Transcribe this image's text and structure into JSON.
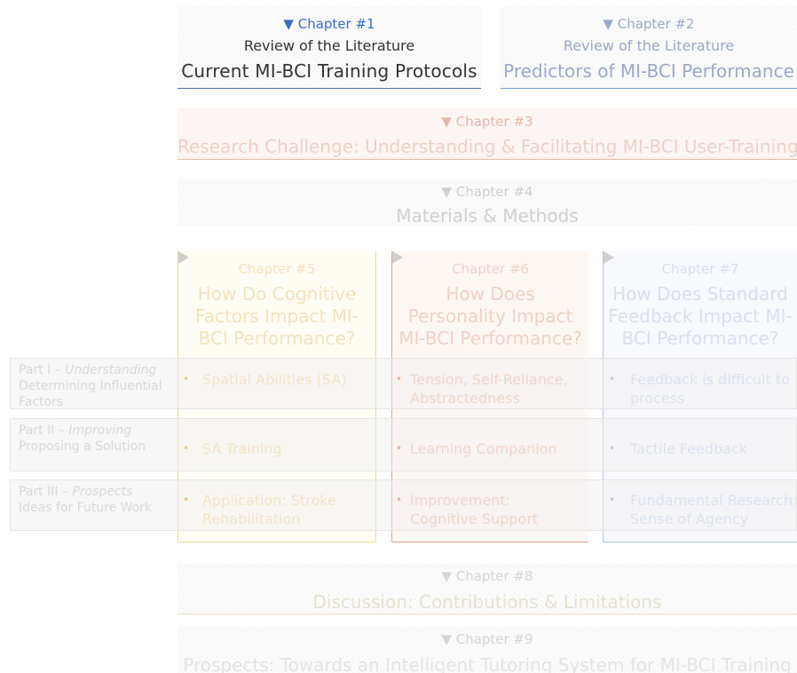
{
  "chapters": {
    "ch1": {
      "label": "▼ Chapter #1",
      "subtitle": "Review of the Literature",
      "title": "Current MI-BCI Training Protocols"
    },
    "ch2": {
      "label": "▼ Chapter #2",
      "subtitle": "Review of the Literature",
      "title": "Predictors of MI-BCI Performance"
    },
    "ch3": {
      "label": "▼ Chapter #3",
      "title": "Research Challenge: Understanding & Facilitating MI-BCI User-Training"
    },
    "ch4": {
      "label": "▼ Chapter #4",
      "title": "Materials & Methods"
    },
    "ch5": {
      "label": "Chapter #5",
      "title": "How Do Cognitive Factors Impact MI-BCI Performance?"
    },
    "ch6": {
      "label": "Chapter #6",
      "title": "How Does Personality Impact MI-BCI Performance?"
    },
    "ch7": {
      "label": "Chapter #7",
      "title": "How Does Standard Feedback Impact MI-BCI Performance?"
    },
    "ch8": {
      "label": "▼ Chapter #8",
      "title": "Discussion: Contributions & Limitations"
    },
    "ch9": {
      "label": "▼ Chapter #9",
      "title": "Prospects: Towards an Intelligent Tutoring System for MI-BCI Training"
    }
  },
  "parts": [
    {
      "prefix": "Part I – ",
      "emph": "Understanding",
      "desc": "Determining Influential Factors"
    },
    {
      "prefix": "Part II – ",
      "emph": "Improving",
      "desc": "Proposing a Solution"
    },
    {
      "prefix": "Part III – ",
      "emph": "Prospects",
      "desc": "Ideas for Future Work"
    }
  ],
  "cells": {
    "ch5": [
      "Spatial Abilities (SA)",
      "SA Training",
      "Application: Stroke Rehabilitation"
    ],
    "ch6": [
      "Tension, Self-Reliance, Abstractedness",
      "Learning Companion",
      "Improvement: Cognitive Support"
    ],
    "ch7": [
      "Feedback is difficult to process",
      "Tactile Feedback",
      "Fundamental Research: Sense of Agency"
    ]
  },
  "bullet": "•",
  "colors": {
    "active_blue": "#3b6cc8",
    "ch5_accent": "#f0d894",
    "ch6_accent": "#e5a383",
    "ch7_accent": "#aac3e8"
  }
}
